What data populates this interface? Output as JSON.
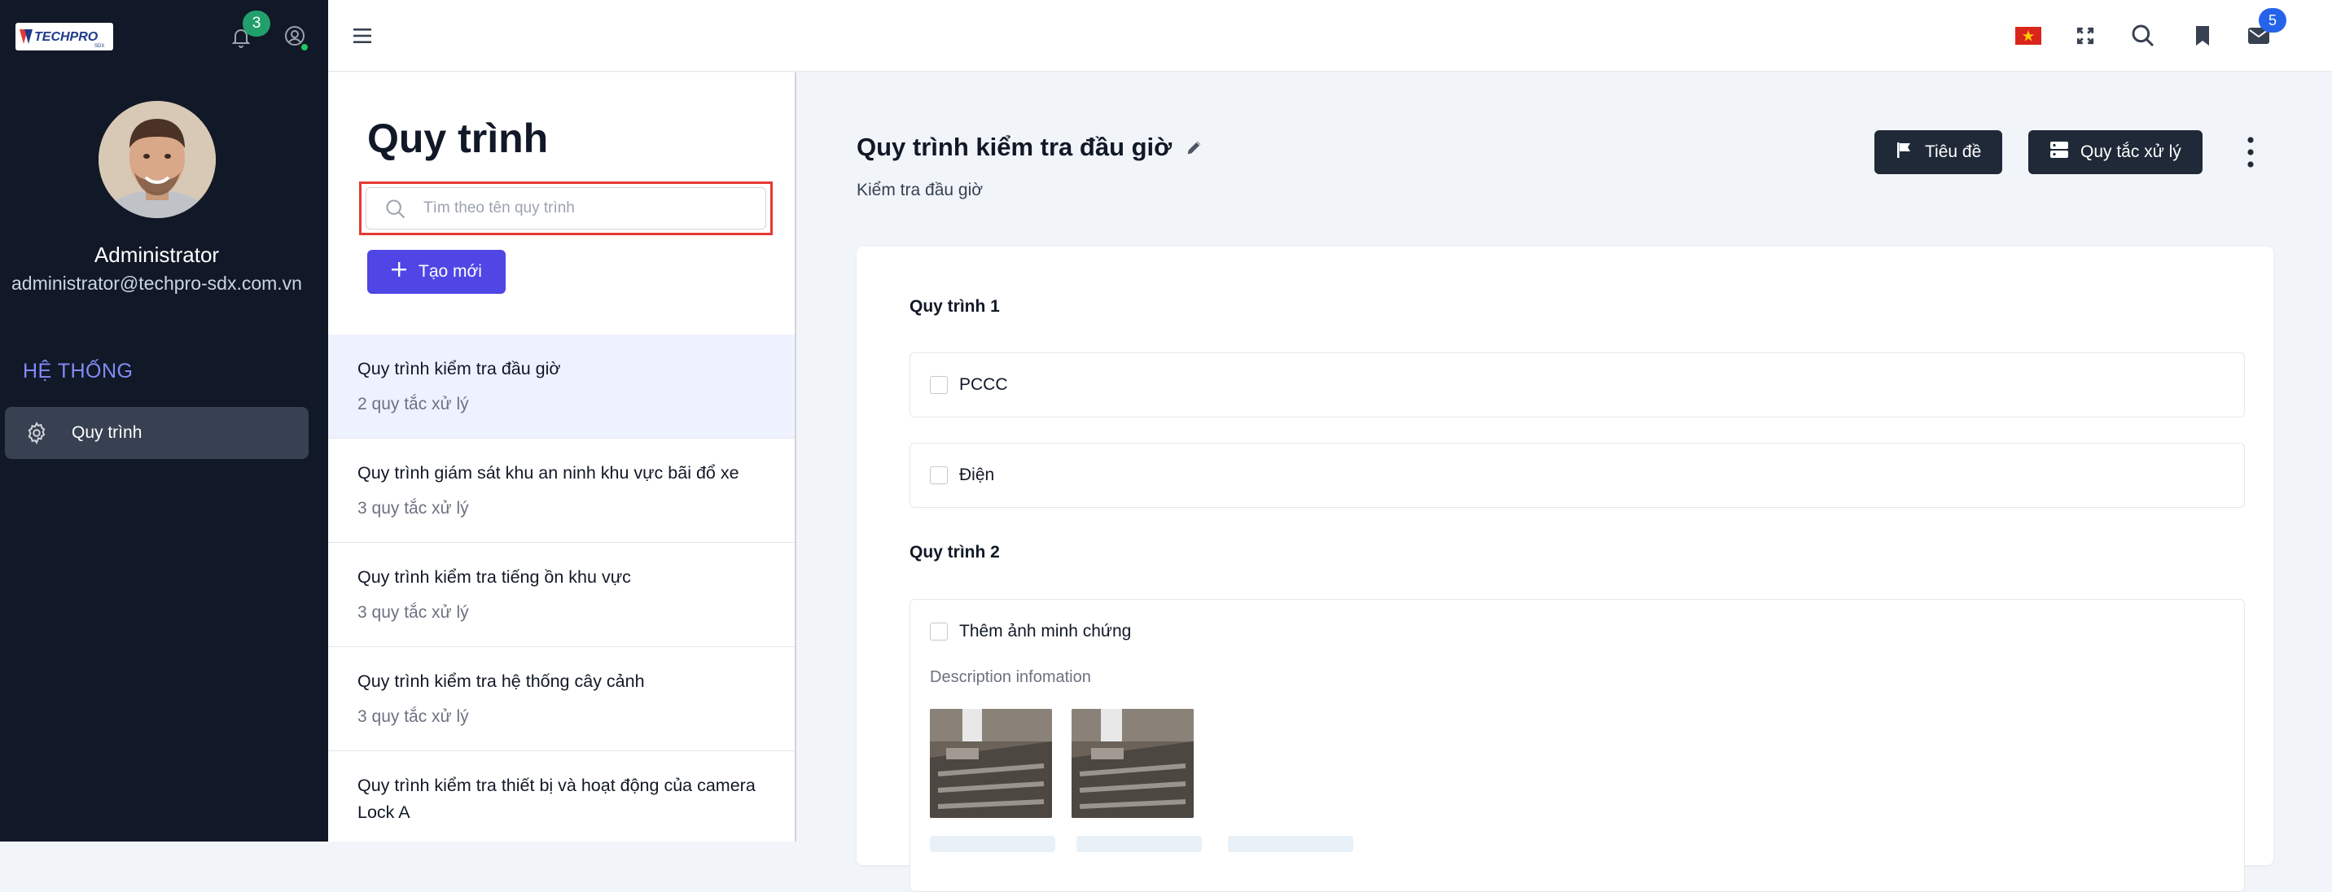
{
  "sidebar": {
    "logo_text": "TECHPRO",
    "logo_sub": "SDX",
    "notification_count": "3",
    "user": {
      "name": "Administrator",
      "email": "administrator@techpro-sdx.com.vn"
    },
    "section_label": "HỆ THỐNG",
    "nav_items": [
      {
        "label": "Quy trình",
        "icon": "gear-icon",
        "active": true
      }
    ]
  },
  "topbar": {
    "icons": [
      "menu-icon",
      "vietnam-flag-icon",
      "fullscreen-icon",
      "search-icon",
      "bookmark-icon",
      "mail-icon"
    ],
    "mail_count": "5"
  },
  "list_panel": {
    "title": "Quy trình",
    "search": {
      "placeholder": "Tìm theo tên quy trình",
      "value": ""
    },
    "create_label": "Tạo mới",
    "items": [
      {
        "name": "Quy trình kiểm tra đầu giờ",
        "count": "2 quy tắc xử lý",
        "active": true
      },
      {
        "name": "Quy trình giám sát khu an ninh khu vực bãi đổ xe",
        "count": "3 quy tắc xử lý"
      },
      {
        "name": "Quy trình kiểm tra tiếng ồn khu vực",
        "count": "3 quy tắc xử lý"
      },
      {
        "name": "Quy trình kiểm tra hệ thống cây cảnh",
        "count": "3 quy tắc xử lý"
      },
      {
        "name": "Quy trình kiểm tra thiết bị và hoạt động của camera Lock A",
        "count": ""
      }
    ]
  },
  "detail": {
    "title": "Quy trình kiểm tra đầu giờ",
    "subtitle": "Kiểm tra đầu giờ",
    "buttons": {
      "heading": "Tiêu đề",
      "rules": "Quy tắc xử lý"
    },
    "groups": [
      {
        "title": "Quy trình 1",
        "tasks": [
          {
            "label": "PCCC"
          },
          {
            "label": "Điện"
          }
        ]
      },
      {
        "title": "Quy trình 2",
        "tasks": [
          {
            "label": "Thêm ảnh minh chứng",
            "description": "Description infomation"
          }
        ]
      }
    ]
  },
  "colors": {
    "sidebar_bg": "#111827",
    "accent": "#4f46e5",
    "dark_button": "#1f2937",
    "highlight_outline": "#e53935",
    "badge_green": "#22a06b",
    "badge_blue": "#2563eb"
  }
}
